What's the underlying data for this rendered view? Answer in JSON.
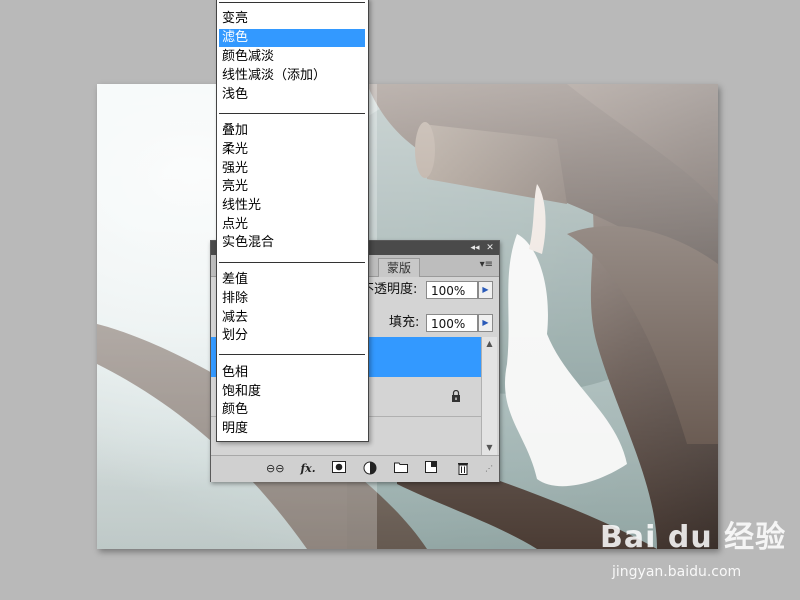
{
  "blend_menu": {
    "groups": [
      [
        "变亮",
        "滤色",
        "颜色减淡",
        "线性减淡（添加）",
        "浅色"
      ],
      [
        "叠加",
        "柔光",
        "强光",
        "亮光",
        "线性光",
        "点光",
        "实色混合"
      ],
      [
        "差值",
        "排除",
        "减去",
        "划分"
      ],
      [
        "色相",
        "饱和度",
        "颜色",
        "明度"
      ]
    ],
    "selected": "滤色"
  },
  "layers_panel": {
    "tabs": [
      "蒙版"
    ],
    "opacity_label": "不透明度:",
    "opacity_value": "100%",
    "fill_label": "填充:",
    "fill_value": "100%",
    "footer_icons": [
      "link-icon",
      "fx-icon",
      "mask-icon",
      "adjustment-icon",
      "folder-icon",
      "new-layer-icon",
      "trash-icon"
    ],
    "fx_label": "fx."
  },
  "watermark": {
    "text": "Bai du 经验",
    "url": "jingyan.baidu.com"
  },
  "colors": {
    "selection": "#3399ff",
    "panel_bg": "#d4d4d4",
    "canvas_bg": "#b9b9b9"
  }
}
